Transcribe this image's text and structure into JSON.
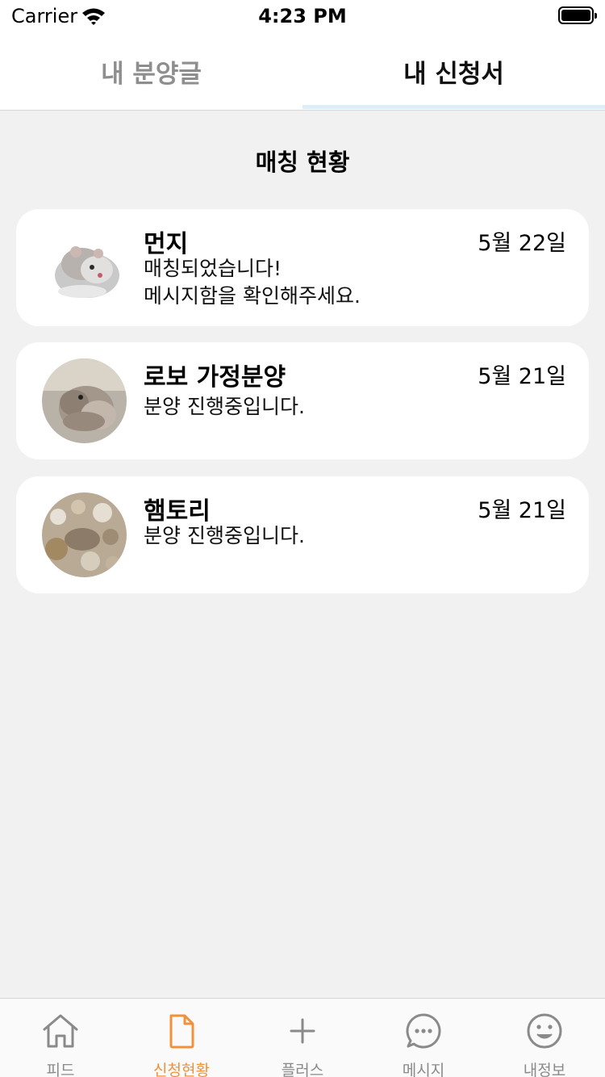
{
  "status_bar": {
    "carrier": "Carrier",
    "time": "4:23 PM"
  },
  "tabs": [
    {
      "label": "내 분양글",
      "active": false
    },
    {
      "label": "내 신청서",
      "active": true
    }
  ],
  "section_title": "매칭 현황",
  "cards": [
    {
      "name": "먼지",
      "date": "5월 22일",
      "lines": [
        "매칭되었습니다!",
        "메시지함을 확인해주세요."
      ],
      "avatar": "hamster-photo"
    },
    {
      "name": "로보 가정분양",
      "date": "5월 21일",
      "lines": [
        "분양 진행중입니다."
      ],
      "avatar": "hamster-photo"
    },
    {
      "name": "햄토리",
      "date": "5월 21일",
      "lines": [
        "분양 진행중입니다."
      ],
      "avatar": "hamster-photo"
    }
  ],
  "bottom_nav": [
    {
      "label": "피드",
      "icon": "home-icon",
      "active": false
    },
    {
      "label": "신청현황",
      "icon": "document-icon",
      "active": true
    },
    {
      "label": "플러스",
      "icon": "plus-icon",
      "active": false
    },
    {
      "label": "메시지",
      "icon": "chat-bubble-icon",
      "active": false
    },
    {
      "label": "내정보",
      "icon": "smiley-icon",
      "active": false
    }
  ],
  "colors": {
    "accent": "#f0913b",
    "inactive": "#8a8a8a",
    "background": "#f1f1f1"
  }
}
